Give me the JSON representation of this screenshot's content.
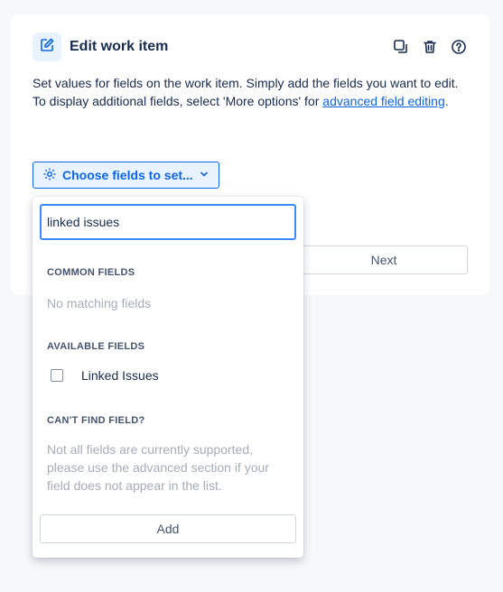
{
  "header": {
    "title": "Edit work item",
    "icons": [
      "edit-icon",
      "duplicate-icon",
      "trash-icon",
      "help-icon"
    ]
  },
  "description": {
    "line1": "Set values for fields on the work item. Simply add the fields you want to edit.",
    "line2_prefix": "To display additional fields, select 'More options' for ",
    "line2_link": "advanced field editing",
    "line2_suffix": "."
  },
  "choose_button": {
    "label": "Choose fields to set..."
  },
  "next_button": {
    "label": "Next"
  },
  "dropdown": {
    "search_value": "linked issues",
    "common_fields_label": "COMMON FIELDS",
    "no_matching": "No matching fields",
    "available_fields_label": "AVAILABLE FIELDS",
    "available_items": [
      {
        "label": "Linked Issues",
        "checked": false
      }
    ],
    "cant_find_label": "CAN'T FIND FIELD?",
    "cant_find_text": "Not all fields are currently supported, please use the advanced section if your field does not appear in the list.",
    "add_label": "Add"
  },
  "colors": {
    "accent": "#0c66e4",
    "accent_bg": "#e9f2ff",
    "focus_border": "#388bff",
    "muted_text": "#a5adba"
  }
}
